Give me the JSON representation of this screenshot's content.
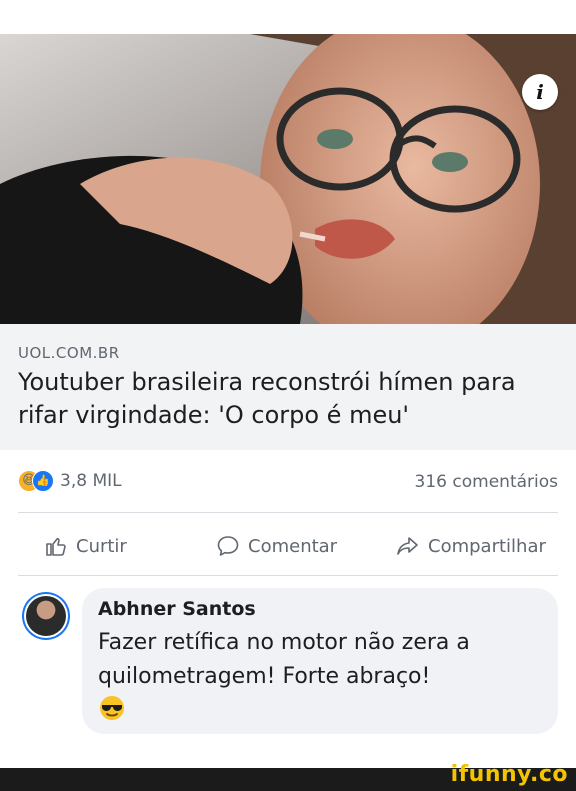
{
  "link": {
    "source": "UOL.COM.BR",
    "headline": "Youtuber brasileira reconstrói hímen para rifar virgindade: 'O corpo é meu'"
  },
  "stats": {
    "reaction_count": "3,8 MIL",
    "comments": "316 comentários"
  },
  "actions": {
    "like": "Curtir",
    "comment": "Comentar",
    "share": "Compartilhar"
  },
  "comment": {
    "author": "Abhner Santos",
    "text": "Fazer retífica no motor não zera a quilometragem! Forte abraço!"
  },
  "watermark": "ifunny.co",
  "colors": {
    "facebook_blue": "#1877f2",
    "link_box_bg": "#f2f3f5",
    "bubble_bg": "#f0f2f5",
    "muted_text": "#606770",
    "watermark": "#f5c400"
  },
  "icons": [
    "info-icon",
    "haha-reaction-icon",
    "like-reaction-icon",
    "thumbs-up-icon",
    "speech-bubble-icon",
    "share-arrow-icon",
    "sunglasses-emoji"
  ]
}
